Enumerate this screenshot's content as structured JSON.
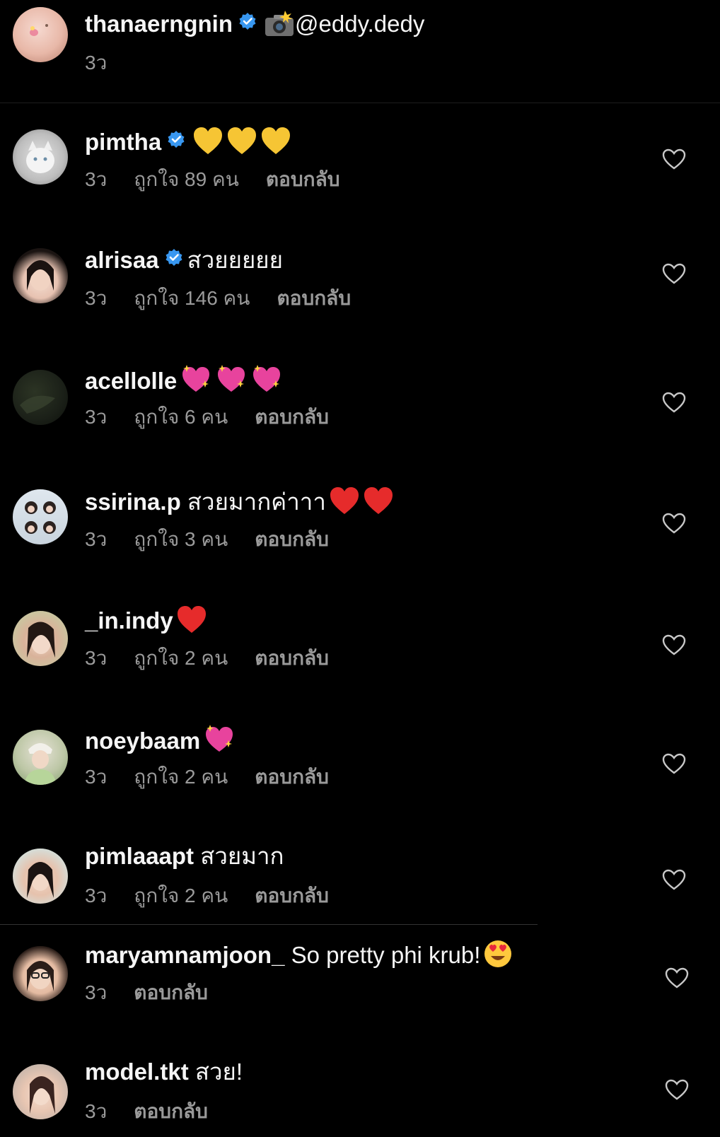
{
  "caption": {
    "username": "thanaerngnin",
    "verified": true,
    "text": "@eddy.dedy",
    "emoji": "camera-flash-icon",
    "time": "3ว"
  },
  "comments": [
    {
      "username": "pimtha",
      "verified": true,
      "text": "",
      "emoji": [
        "yellow-heart-icon",
        "yellow-heart-icon",
        "yellow-heart-icon"
      ],
      "time": "3ว",
      "likes": "ถูกใจ 89 คน",
      "reply": "ตอบกลับ"
    },
    {
      "username": "alrisaa",
      "verified": true,
      "text": "สวยยยยย",
      "emoji": [],
      "time": "3ว",
      "likes": "ถูกใจ 146 คน",
      "reply": "ตอบกลับ"
    },
    {
      "username": "acellolle",
      "verified": false,
      "text": "",
      "emoji": [
        "sparkling-heart-icon",
        "sparkling-heart-icon",
        "sparkling-heart-icon"
      ],
      "time": "3ว",
      "likes": "ถูกใจ 6 คน",
      "reply": "ตอบกลับ"
    },
    {
      "username": "ssirina.p",
      "verified": false,
      "text": "สวยมากค่าาา",
      "emoji": [
        "red-heart-icon",
        "red-heart-icon"
      ],
      "time": "3ว",
      "likes": "ถูกใจ 3 คน",
      "reply": "ตอบกลับ"
    },
    {
      "username": "_in.indy",
      "verified": false,
      "text": "",
      "emoji": [
        "red-heart-icon"
      ],
      "time": "3ว",
      "likes": "ถูกใจ 2 คน",
      "reply": "ตอบกลับ"
    },
    {
      "username": "noeybaam",
      "verified": false,
      "text": "",
      "emoji": [
        "sparkling-heart-icon"
      ],
      "time": "3ว",
      "likes": "ถูกใจ 2 คน",
      "reply": "ตอบกลับ"
    },
    {
      "username": "pimlaaapt",
      "verified": false,
      "text": "สวยมาก",
      "emoji": [],
      "time": "3ว",
      "likes": "ถูกใจ 2 คน",
      "reply": "ตอบกลับ"
    },
    {
      "username": "maryamnamjoon_",
      "verified": false,
      "text": "So pretty phi krub!",
      "emoji": [
        "heart-eyes-face-icon"
      ],
      "time": "3ว",
      "likes": "",
      "reply": "ตอบกลับ"
    },
    {
      "username": "model.tkt",
      "verified": false,
      "text": "สวย!",
      "emoji": [],
      "time": "3ว",
      "likes": "",
      "reply": "ตอบกลับ"
    }
  ],
  "colors": {
    "background": "#000000",
    "text": "#f5f5f5",
    "meta": "#9a9a9a",
    "verified": "#3897f0"
  }
}
